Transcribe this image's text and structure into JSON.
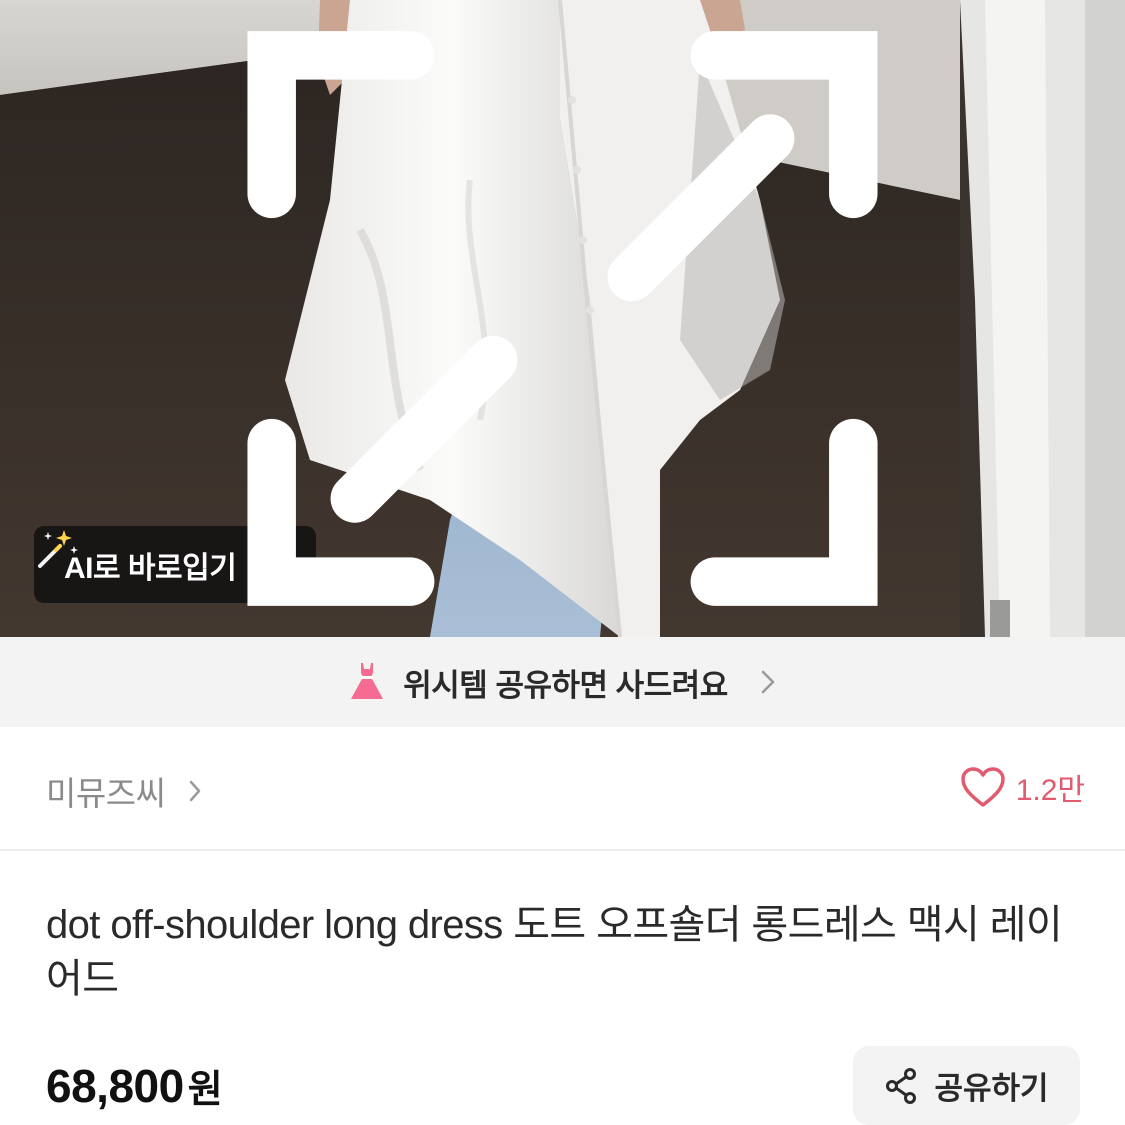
{
  "hero": {
    "ai_button_label": "AI로 바로입기",
    "ai_icon": "magic-wand-icon",
    "expand_icon": "expand-icon"
  },
  "promo": {
    "text": "위시템 공유하면 사드려요",
    "icon": "pink-dress-icon",
    "accent_color": "#f56b92"
  },
  "shop": {
    "name": "미뮤즈씨",
    "like_count": "1.2만",
    "like_color": "#e25a6e"
  },
  "product": {
    "title": "dot off-shoulder long dress 도트 오프숄더 롱드레스 맥시 레이어드",
    "price": "68,800",
    "currency": "원"
  },
  "actions": {
    "share_label": "공유하기",
    "share_icon": "share-icon"
  }
}
